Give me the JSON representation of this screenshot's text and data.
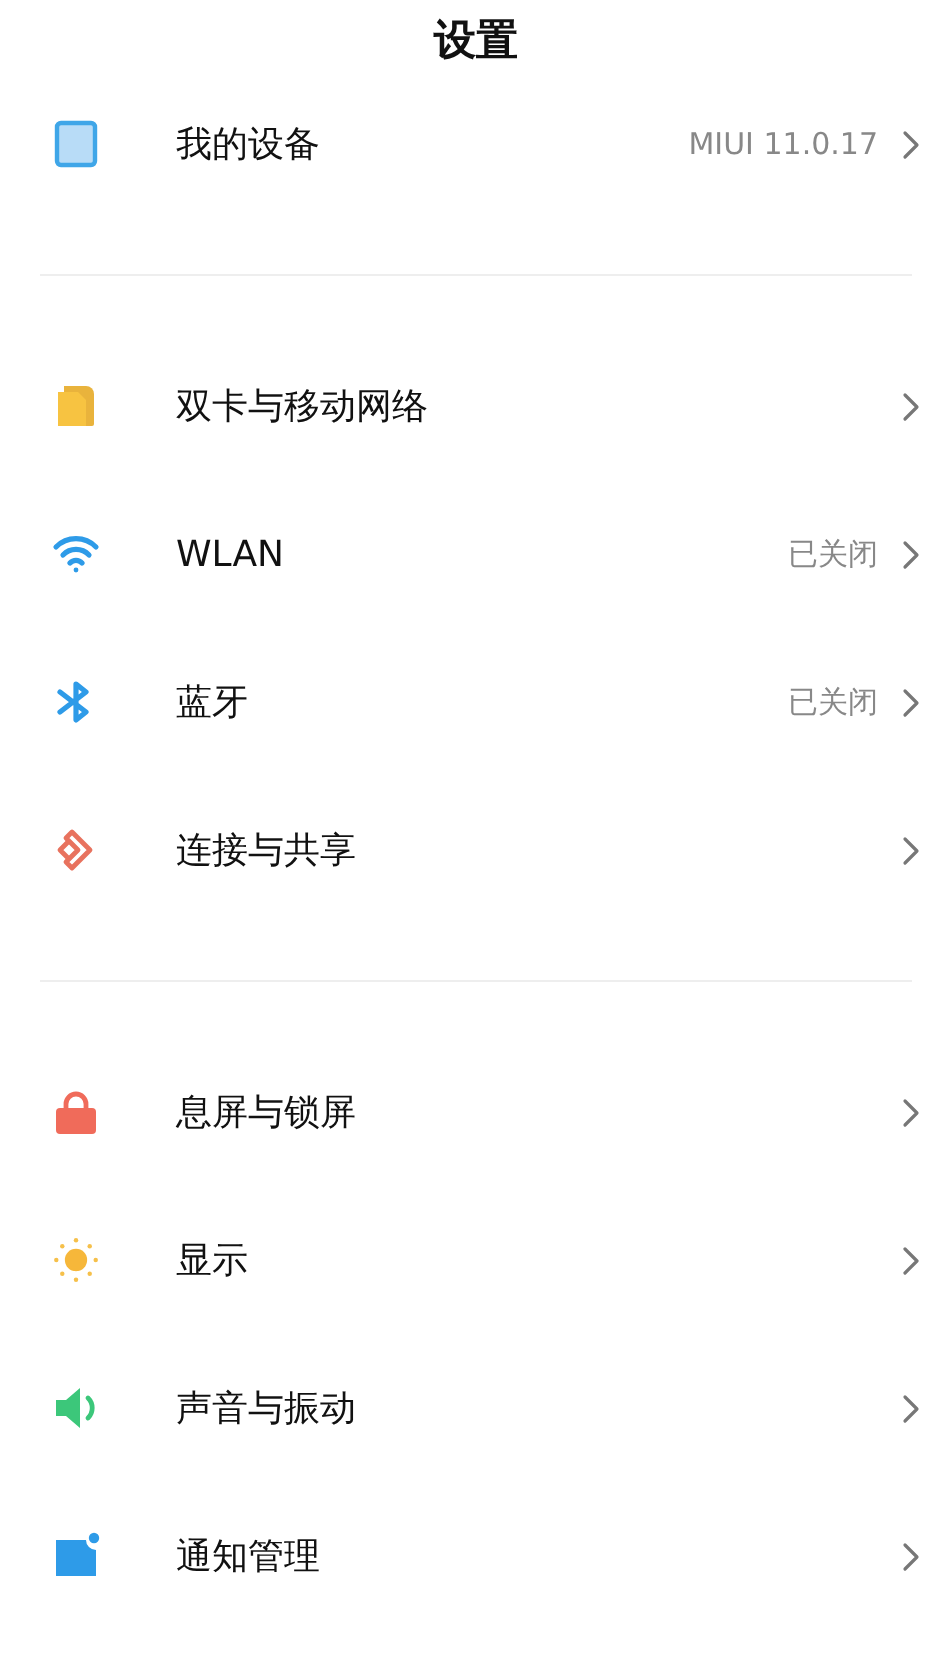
{
  "title": "设置",
  "groups": [
    {
      "items": [
        {
          "kind": "device",
          "label": "我的设备",
          "value": "MIUI 11.0.17"
        }
      ]
    },
    {
      "items": [
        {
          "kind": "sim",
          "label": "双卡与移动网络"
        },
        {
          "kind": "wifi",
          "label": "WLAN",
          "value": "已关闭"
        },
        {
          "kind": "bluetooth",
          "label": "蓝牙",
          "value": "已关闭"
        },
        {
          "kind": "share",
          "label": "连接与共享"
        }
      ]
    },
    {
      "items": [
        {
          "kind": "lock",
          "label": "息屏与锁屏"
        },
        {
          "kind": "sun",
          "label": "显示"
        },
        {
          "kind": "sound",
          "label": "声音与振动"
        },
        {
          "kind": "notify",
          "label": "通知管理"
        }
      ]
    }
  ]
}
